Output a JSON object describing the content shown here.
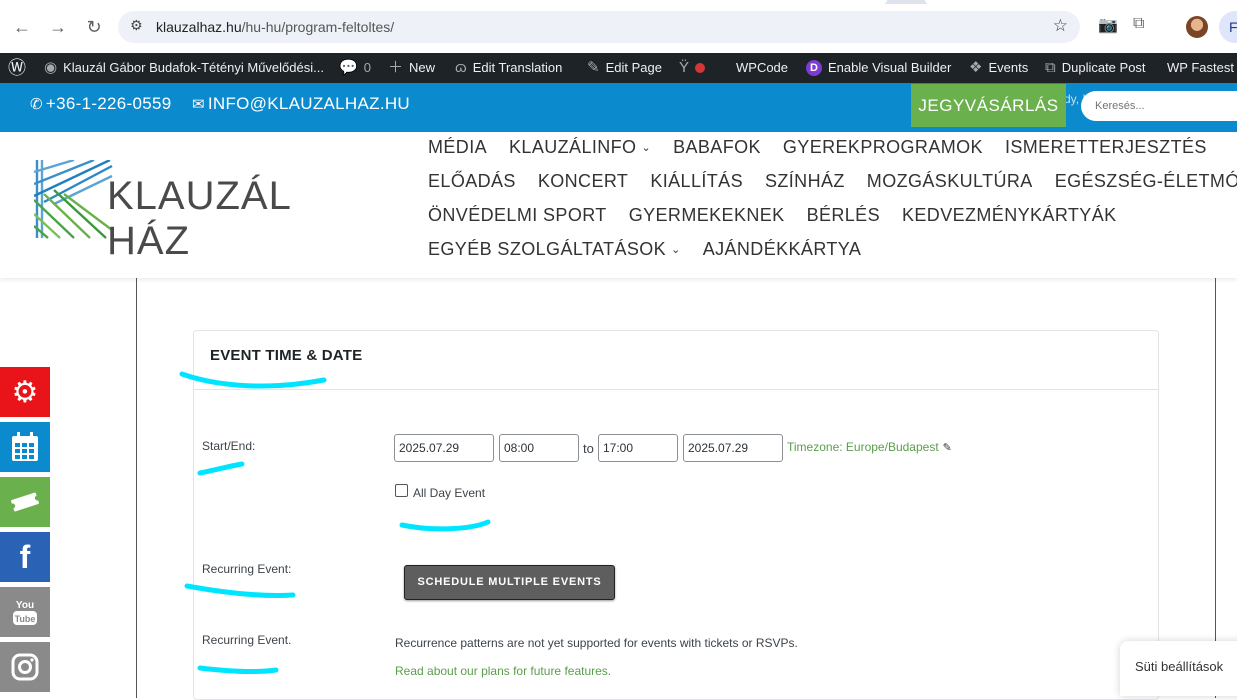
{
  "browser": {
    "url_domain": "klauzalhaz.hu",
    "url_path": "/hu-hu/program-feltoltes/",
    "profile_initial": "F"
  },
  "admin_bar": {
    "site_name": "Klauzál Gábor Budafok-Tétényi Művelődési...",
    "comments_count": "0",
    "new_label": "New",
    "edit_translation": "Edit Translation",
    "edit_page": "Edit Page",
    "wpcode": "WPCode",
    "visual_builder": "Enable Visual Builder",
    "events": "Events",
    "duplicate_post": "Duplicate Post",
    "wp_fastest": "WP Fastest C"
  },
  "topbar": {
    "phone": "+36-1-226-0559",
    "email": "INFO@KLAUZALHAZ.HU",
    "ticket_button": "JEGYVÁSÁRLÁS",
    "howdy": "Howdy, Klauzál Gábor Művelődési",
    "search_placeholder": "Keresés..."
  },
  "header": {
    "logo_text": "KLAUZÁL HÁZ",
    "menu_rows": [
      [
        "MÉDIA",
        "KLAUZÁLINFO",
        "BABAFOK",
        "GYEREKPROGRAMOK",
        "ISMERETTERJESZTÉS"
      ],
      [
        "ELŐADÁS",
        "KONCERT",
        "KIÁLLÍTÁS",
        "SZÍNHÁZ",
        "MOZGÁSKULTÚRA",
        "EGÉSZSÉG-ÉLETMÓD"
      ],
      [
        "ÖNVÉDELMI SPORT",
        "GYERMEKEKNEK",
        "BÉRLÉS",
        "KEDVEZMÉNYKÁRTYÁK"
      ],
      [
        "EGYÉB SZOLGÁLTATÁSOK",
        "AJÁNDÉKKÁRTYA"
      ]
    ]
  },
  "panel": {
    "title": "EVENT TIME & DATE",
    "start_end_label": "Start/End:",
    "start_date": "2025.07.29",
    "start_time": "08:00",
    "to_label": "to",
    "end_time": "17:00",
    "end_date": "2025.07.29",
    "timezone": "Timezone: Europe/Budapest",
    "all_day_label": "All Day Event",
    "all_day_checked": false,
    "recurring_label_1": "Recurring Event:",
    "schedule_button": "SCHEDULE MULTIPLE EVENTS",
    "recurring_label_2": "Recurring Event.",
    "recurrence_note": "Recurrence patterns are not yet supported for events with tickets or RSVPs.",
    "plans_link": "Read about our plans for future features."
  },
  "sidebar": {
    "items": [
      {
        "name": "settings",
        "color": "#e8141a"
      },
      {
        "name": "calendar",
        "color": "#0c8ace"
      },
      {
        "name": "ticket",
        "color": "#6ab04c"
      },
      {
        "name": "facebook",
        "color": "#2a63b6"
      },
      {
        "name": "youtube",
        "color": "#8a8a8a"
      },
      {
        "name": "instagram",
        "color": "#8a8a8a"
      }
    ]
  },
  "cookie": {
    "label": "Süti beállítások"
  },
  "colors": {
    "brand_blue": "#0c8ace",
    "brand_green": "#6ab04c",
    "link_green": "#5a9e4b",
    "annotation_cyan": "#00e5ff"
  }
}
